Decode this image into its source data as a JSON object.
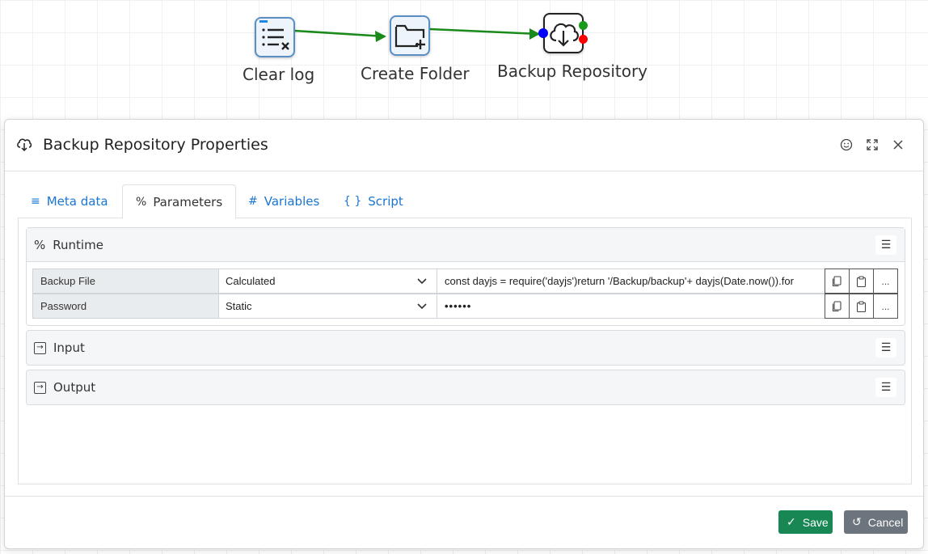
{
  "flow": {
    "nodes": [
      {
        "label": "Clear log",
        "icon": "clear-list-icon"
      },
      {
        "label": "Create Folder",
        "icon": "folder-plus-icon"
      },
      {
        "label": "Backup Repository",
        "icon": "cloud-download-icon"
      }
    ],
    "connector_color": "#1a8a1a"
  },
  "modal": {
    "title": "Backup Repository Properties",
    "title_icon": "cloud-download-icon",
    "header_buttons": [
      "smiley-icon",
      "expand-icon",
      "close-icon"
    ]
  },
  "tabs": [
    {
      "icon": "≡",
      "label": "Meta data"
    },
    {
      "icon": "%",
      "label": "Parameters"
    },
    {
      "icon": "#",
      "label": "Variables"
    },
    {
      "icon": "{ }",
      "label": "Script"
    }
  ],
  "sections": {
    "runtime": {
      "title": "Runtime",
      "icon": "%",
      "rows": [
        {
          "label": "Backup File",
          "mode": "Calculated",
          "value": "const dayjs = require('dayjs')return '/Backup/backup'+ dayjs(Date.now()).for"
        },
        {
          "label": "Password",
          "mode": "Static",
          "value": "••••••"
        }
      ],
      "row_button_more": "..."
    },
    "input": {
      "title": "Input"
    },
    "output": {
      "title": "Output"
    }
  },
  "footer": {
    "save_label": "Save",
    "cancel_label": "Cancel"
  },
  "colors": {
    "tab_link": "#1976d2",
    "save": "#198754",
    "cancel": "#6c757d",
    "port_in": "#0000ff",
    "port_ok": "#1a9a1a",
    "port_err": "#ff0000"
  }
}
